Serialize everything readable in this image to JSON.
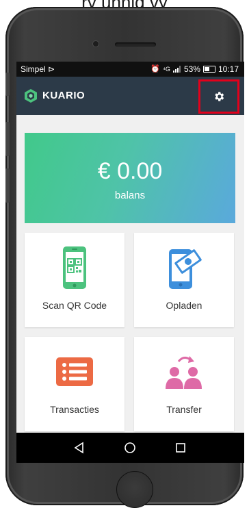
{
  "caption": {
    "text": "ry unnig vy"
  },
  "status_bar": {
    "carrier": "Simpel ⊳",
    "network": "⁴G",
    "battery_percent": "53%",
    "time": "10:17"
  },
  "app_bar": {
    "brand": "KUARIO",
    "settings_icon": "gear-icon",
    "highlight_color": "#e3001b"
  },
  "balance": {
    "amount": "€ 0.00",
    "label": "balans"
  },
  "tiles": [
    {
      "label": "Scan QR Code",
      "icon": "qr-phone-icon",
      "color": "#4cc27e"
    },
    {
      "label": "Opladen",
      "icon": "phone-money-icon",
      "color": "#3d8fdc"
    },
    {
      "label": "Transacties",
      "icon": "list-icon",
      "color": "#ec6a44"
    },
    {
      "label": "Transfer",
      "icon": "users-transfer-icon",
      "color": "#de6aa6"
    }
  ],
  "nav": {
    "back_icon": "back-triangle-icon",
    "home_icon": "home-circle-icon",
    "recents_icon": "recents-square-icon"
  },
  "colors": {
    "app_bar": "#2c3a48",
    "status_bar": "#101010",
    "screen_bg": "#f0f0f0",
    "balance_gradient_start": "#41c98a",
    "balance_gradient_end": "#5aa9dc"
  }
}
